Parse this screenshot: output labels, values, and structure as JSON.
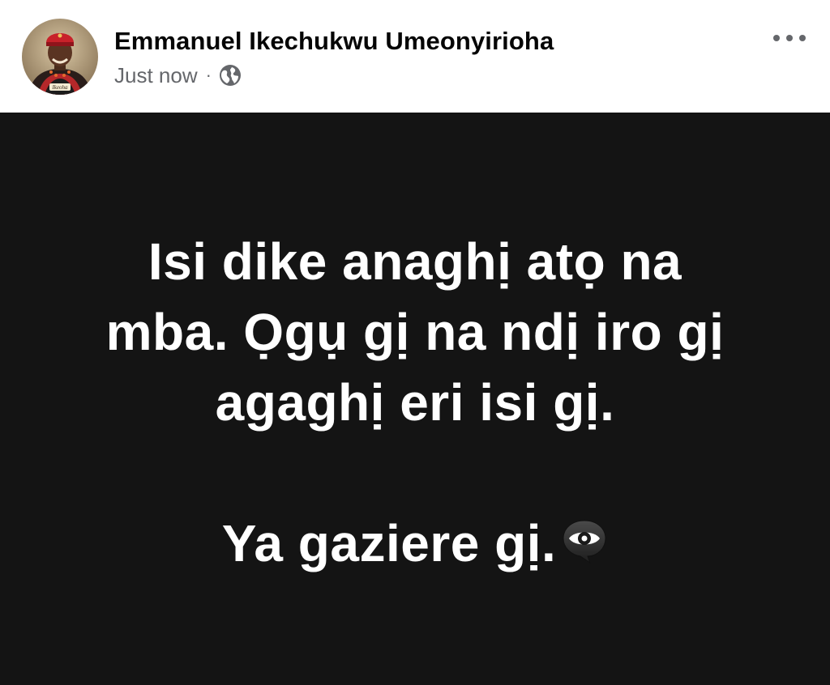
{
  "post": {
    "author": {
      "name": "Emmanuel Ikechukwu Umeonyirioha",
      "avatar_icon": "profile-photo",
      "avatar_badge_text": "Ikeoha"
    },
    "meta": {
      "timestamp": "Just now",
      "separator": "·",
      "audience_icon": "globe-icon"
    },
    "more_icon": "more-options-icon",
    "status": {
      "background_color": "#141414",
      "text_color": "#ffffff",
      "lines": [
        "Isi dike anaghị atọ na",
        "mba. Ọgụ gị na ndị iro gị",
        "agaghị eri isi gị."
      ],
      "closing_line": "Ya gaziere gị.",
      "emoji": "eye-in-speech-bubble-icon"
    }
  }
}
